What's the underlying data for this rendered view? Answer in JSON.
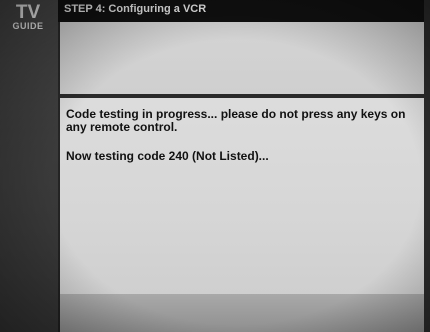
{
  "logo": {
    "line1": "TV",
    "line2": "GUIDE"
  },
  "header": {
    "title": "STEP 4: Configuring a VCR"
  },
  "main": {
    "message": "Code testing in progress... please do not press any keys on any remote control.",
    "status": "Now testing code 240 (Not Listed)..."
  },
  "colors": {
    "sidebar": "#3c3c3c",
    "header_bg": "#101010",
    "panel_bg": "#d6d6d6",
    "text": "#111111"
  }
}
